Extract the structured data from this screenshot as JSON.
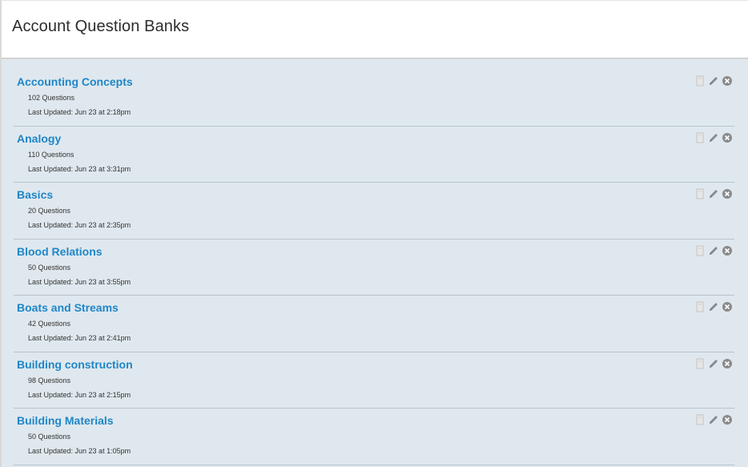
{
  "header": {
    "title": "Account Question Banks"
  },
  "banks": [
    {
      "title": "Accounting Concepts",
      "count": "102 Questions",
      "updated": "Last Updated: Jun 23 at 2:18pm"
    },
    {
      "title": "Analogy",
      "count": "110 Questions",
      "updated": "Last Updated: Jun 23 at 3:31pm"
    },
    {
      "title": "Basics",
      "count": "20 Questions",
      "updated": "Last Updated: Jun 23 at 2:35pm"
    },
    {
      "title": "Blood Relations",
      "count": "50 Questions",
      "updated": "Last Updated: Jun 23 at 3:55pm"
    },
    {
      "title": "Boats and Streams",
      "count": "42 Questions",
      "updated": "Last Updated: Jun 23 at 2:41pm"
    },
    {
      "title": "Building construction",
      "count": "98 Questions",
      "updated": "Last Updated: Jun 23 at 2:15pm"
    },
    {
      "title": "Building Materials",
      "count": "50 Questions",
      "updated": "Last Updated: Jun 23 at 1:05pm"
    }
  ],
  "icons": {
    "bookmark": "bookmark-icon",
    "edit": "pencil-icon",
    "delete": "close-circle-icon"
  },
  "colors": {
    "link": "#1f86c8",
    "background": "#dfe8ee",
    "icon": "#8a8a8a"
  }
}
